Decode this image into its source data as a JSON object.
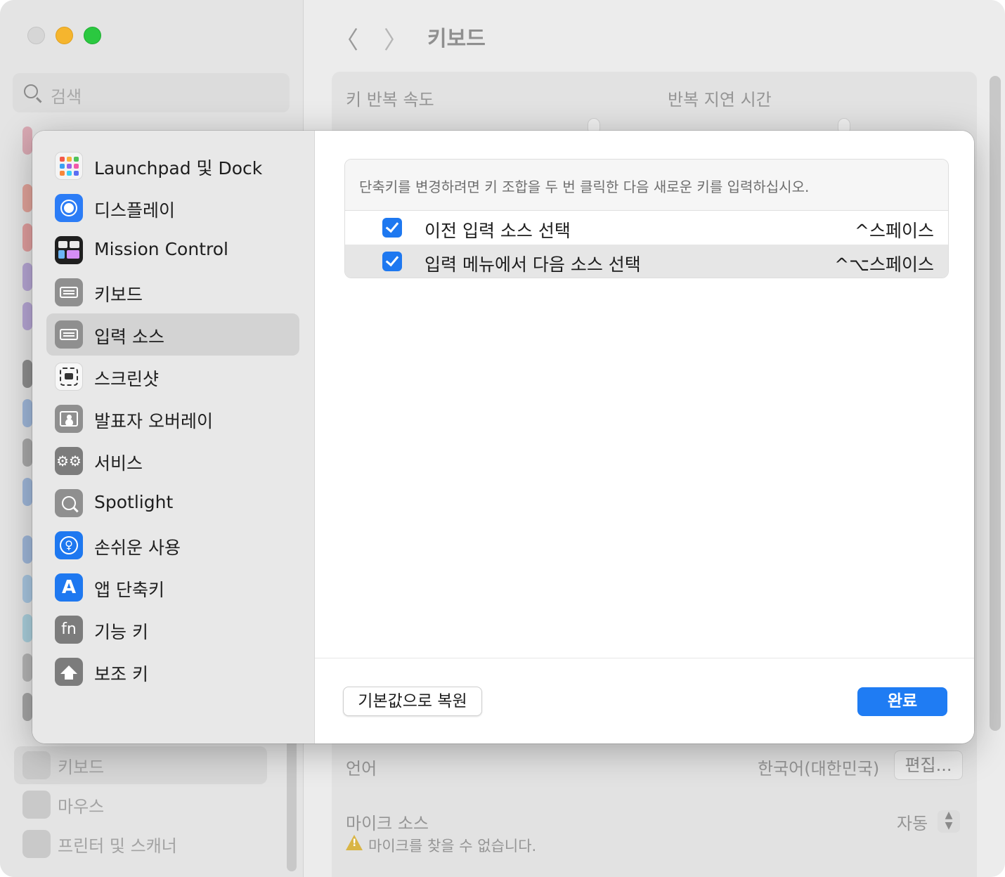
{
  "window": {
    "title": "키보드",
    "search_placeholder": "검색",
    "sidebar_visible": [
      {
        "label": "키보드",
        "selected": true
      },
      {
        "label": "마우스",
        "selected": false
      },
      {
        "label": "프린터 및 스캐너",
        "selected": false
      }
    ],
    "panel": {
      "key_repeat_label": "키 반복 속도",
      "repeat_delay_label": "반복 지연 시간",
      "language_label": "언어",
      "language_value": "한국어(대한민국)",
      "edit_button": "편집...",
      "mic_source_label": "마이크 소스",
      "mic_source_value": "자동",
      "mic_warning": "마이크를 찾을 수 없습니다."
    }
  },
  "sheet": {
    "categories": [
      {
        "label": "Launchpad 및 Dock",
        "icon": "launchpad-icon",
        "selected": false
      },
      {
        "label": "디스플레이",
        "icon": "display-icon",
        "selected": false
      },
      {
        "label": "Mission Control",
        "icon": "mission-control-icon",
        "selected": false
      },
      {
        "label": "키보드",
        "icon": "keyboard-icon",
        "selected": false
      },
      {
        "label": "입력 소스",
        "icon": "input-sources-icon",
        "selected": true
      },
      {
        "label": "스크린샷",
        "icon": "screenshot-icon",
        "selected": false
      },
      {
        "label": "발표자 오버레이",
        "icon": "presenter-overlay-icon",
        "selected": false
      },
      {
        "label": "서비스",
        "icon": "services-icon",
        "selected": false
      },
      {
        "label": "Spotlight",
        "icon": "spotlight-icon",
        "selected": false
      },
      {
        "label": "손쉬운 사용",
        "icon": "accessibility-icon",
        "selected": false
      },
      {
        "label": "앱 단축키",
        "icon": "app-shortcuts-icon",
        "selected": false
      },
      {
        "label": "기능 키",
        "icon": "function-keys-icon",
        "selected": false
      },
      {
        "label": "보조 키",
        "icon": "modifier-keys-icon",
        "selected": false
      }
    ],
    "hint": "단축키를 변경하려면 키 조합을 두 번 클릭한 다음 새로운 키를 입력하십시오.",
    "shortcuts": [
      {
        "label": "이전 입력 소스 선택",
        "keys": "^스페이스",
        "checked": true
      },
      {
        "label": "입력 메뉴에서 다음 소스 선택",
        "keys": "^⌥스페이스",
        "checked": true
      }
    ],
    "restore_button": "기본값으로 복원",
    "done_button": "완료",
    "fn_icon_text": "fn"
  },
  "colors": {
    "accent": "#1f7cf3",
    "selection": "#d3d3d3",
    "close_light": "#d6d6d6",
    "minimize_light": "#f5b52e",
    "zoom_light": "#2bc840"
  }
}
